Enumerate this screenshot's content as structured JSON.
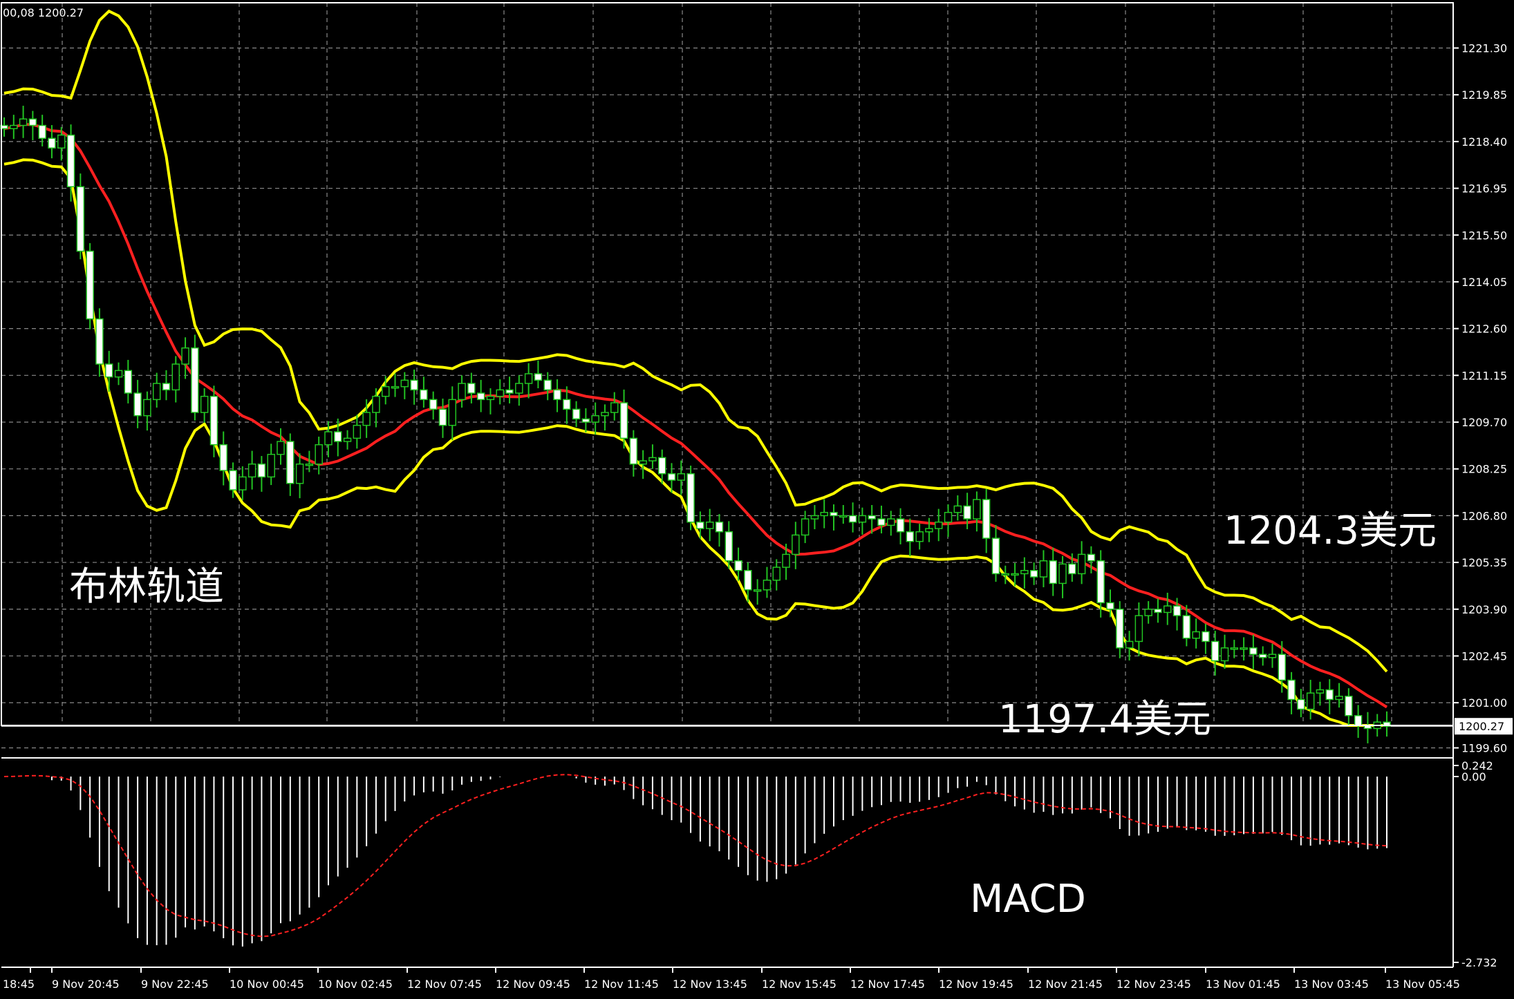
{
  "chart_data": [
    {
      "type": "candlestick",
      "header": "00,08 1200.27",
      "ylim": [
        1199.0,
        1222.5
      ],
      "y_ticks": [
        "1221.30",
        "1219.85",
        "1218.40",
        "1216.95",
        "1215.50",
        "1214.05",
        "1212.60",
        "1211.15",
        "1209.70",
        "1208.25",
        "1206.80",
        "1205.35",
        "1203.90",
        "1202.45",
        "1201.00",
        "1199.60"
      ],
      "current_price": "1200.27",
      "x_ticks": [
        "18:45",
        "9 Nov 20:45",
        "9 Nov 22:45",
        "10 Nov 00:45",
        "10 Nov 02:45",
        "12 Nov 07:45",
        "12 Nov 09:45",
        "12 Nov 11:45",
        "12 Nov 13:45",
        "12 Nov 15:45",
        "12 Nov 17:45",
        "12 Nov 19:45",
        "12 Nov 21:45",
        "12 Nov 23:45",
        "13 Nov 01:45",
        "13 Nov 03:45",
        "13 Nov 05:45"
      ],
      "closes": [
        1218.8,
        1218.9,
        1219.1,
        1218.9,
        1218.5,
        1218.2,
        1218.6,
        1217.0,
        1215.0,
        1212.9,
        1211.5,
        1211.1,
        1211.3,
        1210.6,
        1209.9,
        1210.4,
        1210.9,
        1210.7,
        1211.5,
        1212.0,
        1210.0,
        1210.5,
        1209.0,
        1208.2,
        1207.6,
        1208.0,
        1208.4,
        1208.0,
        1208.7,
        1209.1,
        1207.8,
        1208.4,
        1208.4,
        1209.0,
        1209.4,
        1209.1,
        1209.2,
        1209.6,
        1210.0,
        1210.5,
        1210.8,
        1210.8,
        1211.0,
        1210.7,
        1210.4,
        1210.1,
        1209.6,
        1210.4,
        1210.9,
        1210.6,
        1210.4,
        1210.5,
        1210.7,
        1210.6,
        1210.9,
        1211.2,
        1211.0,
        1210.7,
        1210.4,
        1210.1,
        1209.8,
        1209.7,
        1209.9,
        1210.0,
        1210.3,
        1209.2,
        1208.4,
        1208.5,
        1208.6,
        1208.1,
        1207.9,
        1208.1,
        1206.6,
        1206.4,
        1206.6,
        1206.3,
        1205.4,
        1205.1,
        1204.5,
        1204.5,
        1204.8,
        1205.2,
        1205.6,
        1206.2,
        1206.7,
        1206.8,
        1206.9,
        1206.8,
        1206.8,
        1206.6,
        1206.8,
        1206.7,
        1206.5,
        1206.7,
        1206.3,
        1206.0,
        1206.3,
        1206.4,
        1206.6,
        1206.9,
        1207.1,
        1206.7,
        1207.3,
        1206.1,
        1205.0,
        1205.0,
        1205.0,
        1205.1,
        1204.9,
        1205.4,
        1204.7,
        1205.3,
        1205.0,
        1205.6,
        1205.4,
        1204.1,
        1203.9,
        1202.7,
        1202.9,
        1203.7,
        1203.9,
        1203.8,
        1204.0,
        1203.7,
        1203.0,
        1203.2,
        1202.9,
        1202.3,
        1202.7,
        1202.7,
        1202.7,
        1202.5,
        1202.4,
        1202.5,
        1201.7,
        1201.1,
        1200.8,
        1201.3,
        1201.4,
        1201.1,
        1201.2,
        1200.6,
        1200.3,
        1200.2,
        1200.4,
        1200.27
      ],
      "overlays": [
        {
          "name": "布林轨道 upper",
          "color": "#ffff00"
        },
        {
          "name": "布林轨道 middle",
          "color": "#ff2020"
        },
        {
          "name": "布林轨道 lower",
          "color": "#ffff00"
        }
      ],
      "annotations": [
        "布林轨道",
        "1204.3美元",
        "1197.4美元"
      ]
    },
    {
      "type": "histogram",
      "name": "MACD",
      "y_ticks": [
        "0.242",
        "0.00",
        "-2.732"
      ],
      "ylim": [
        -2.732,
        0.242
      ],
      "signal_color": "#ff2020",
      "histogram_color": "#ffffff"
    }
  ]
}
